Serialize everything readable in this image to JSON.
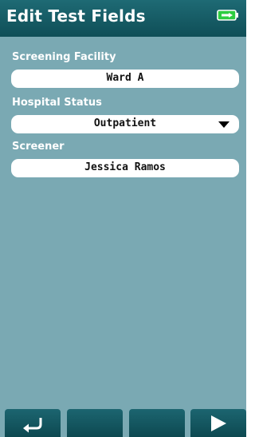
{
  "header": {
    "title": "Edit Test Fields",
    "battery_icon": "battery-charging-icon"
  },
  "fields": [
    {
      "label": "Screening Facility",
      "value": "Ward A",
      "type": "text"
    },
    {
      "label": "Hospital Status",
      "value": "Outpatient",
      "type": "dropdown"
    },
    {
      "label": "Screener",
      "value": "Jessica Ramos",
      "type": "text"
    }
  ],
  "footer": {
    "buttons": [
      {
        "icon": "return-icon"
      },
      {
        "icon": ""
      },
      {
        "icon": ""
      },
      {
        "icon": "play-icon"
      }
    ]
  },
  "colors": {
    "background": "#7aa9b3",
    "header": "#1e6a74",
    "battery": "#2ecc40"
  }
}
